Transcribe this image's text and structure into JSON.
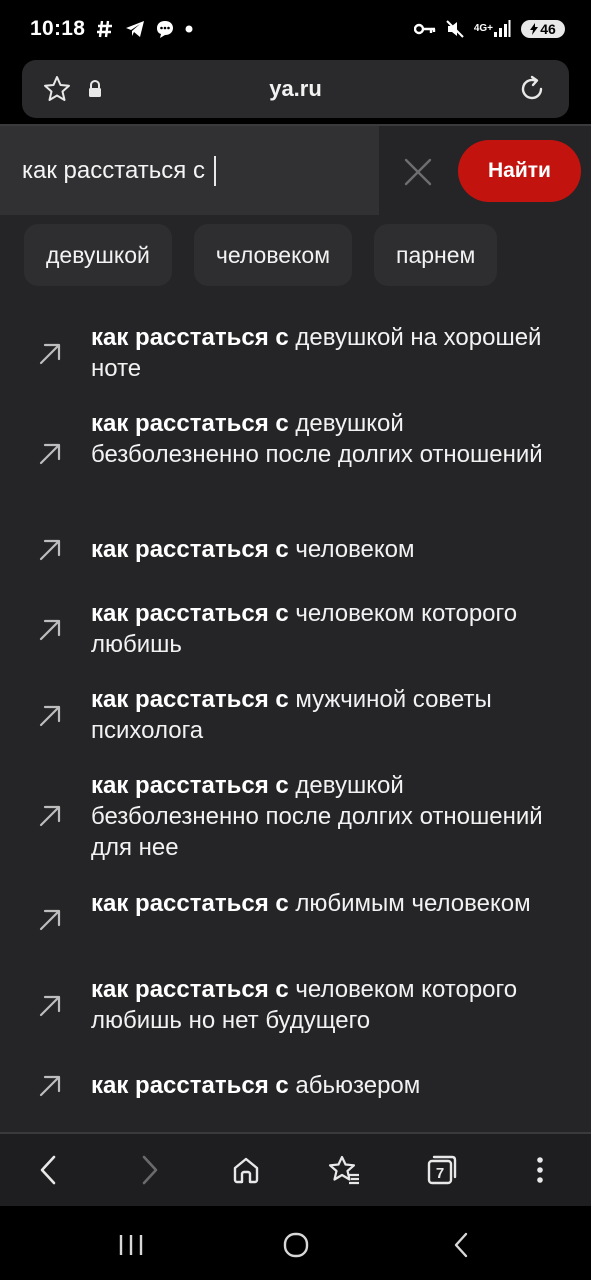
{
  "status_bar": {
    "time": "10:18",
    "left_icons": [
      "hashtag-icon",
      "telegram-icon",
      "chat-bubble-icon",
      "dot-icon"
    ],
    "network": "4G+",
    "battery": "46",
    "right_icons": [
      "key-icon",
      "mute-icon",
      "signal-icon",
      "battery-icon"
    ]
  },
  "address_bar": {
    "url": "ya.ru",
    "icons": [
      "star-icon",
      "lock-icon",
      "reload-icon"
    ]
  },
  "search": {
    "query": "как расстаться с ",
    "button_label": "Найти",
    "clear_icon": "close-icon",
    "accent_color": "#c3130f"
  },
  "chips": [
    {
      "label": "девушкой"
    },
    {
      "label": "человеком"
    },
    {
      "label": "парнем"
    }
  ],
  "suggestions": [
    {
      "bold": "как расстаться с",
      "rest": " девушкой на хорошей ноте"
    },
    {
      "bold": "как расстаться с",
      "rest": " девушкой безболезненно после долгих отношений"
    },
    {
      "bold": "как расстаться с",
      "rest": " человеком"
    },
    {
      "bold": "как расстаться с",
      "rest": " человеком которого любишь"
    },
    {
      "bold": "как расстаться с",
      "rest": " мужчиной советы психолога"
    },
    {
      "bold": "как расстаться с",
      "rest": " девушкой безболезненно после долгих отношений для нее"
    },
    {
      "bold": "как расстаться с",
      "rest": " любимым человеком"
    },
    {
      "bold": "как расстаться с",
      "rest": " человеком которого любишь но нет будущего"
    },
    {
      "bold": "как расстаться с",
      "rest": " абьюзером"
    }
  ],
  "toolbar": {
    "tabs_count": "7",
    "icons": [
      "back-icon",
      "forward-icon",
      "home-icon",
      "bookmarks-icon",
      "tabs-icon",
      "more-icon"
    ]
  },
  "system_nav": {
    "icons": [
      "recents-icon",
      "home-circle-icon",
      "back-nav-icon"
    ]
  }
}
